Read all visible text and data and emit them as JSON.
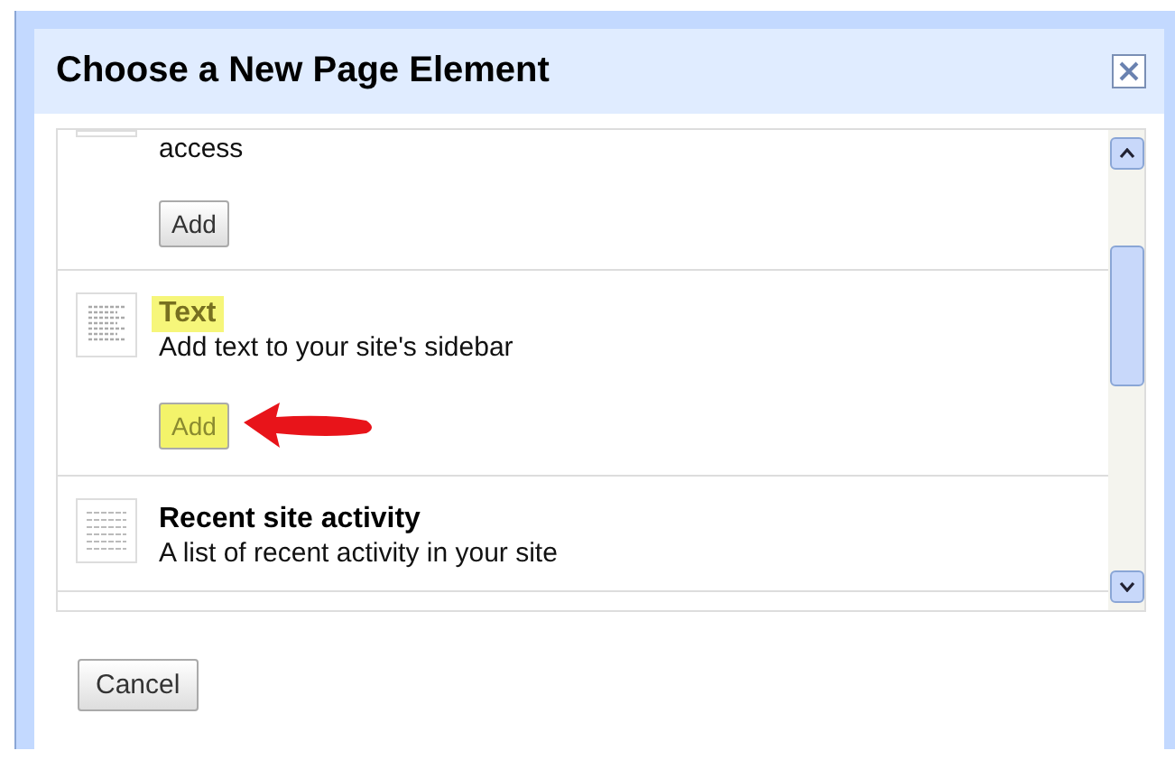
{
  "dialog": {
    "title": "Choose a New Page Element"
  },
  "elements": [
    {
      "description": "access",
      "button": "Add",
      "highlighted": false,
      "kind": "cut"
    },
    {
      "name": "Text",
      "description": "Add text to your site's sidebar",
      "button": "Add",
      "highlighted": true,
      "kind": "text"
    },
    {
      "name": "Recent site activity",
      "description": "A list of recent activity in your site",
      "highlighted": false,
      "kind": "list"
    }
  ],
  "footer": {
    "cancel": "Cancel"
  }
}
